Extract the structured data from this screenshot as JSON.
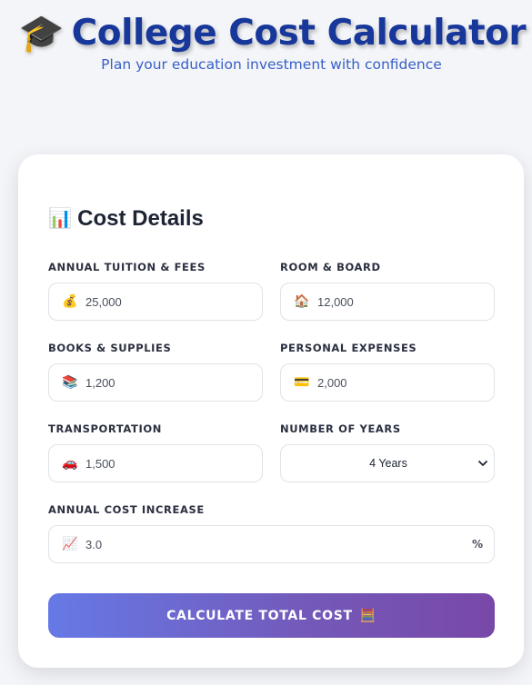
{
  "header": {
    "icon": "🎓",
    "title": "College Cost Calculator",
    "subtitle": "Plan your education investment with confidence"
  },
  "section": {
    "icon": "📊",
    "title": "Cost Details"
  },
  "fields": {
    "tuition": {
      "label": "Annual Tuition & Fees",
      "icon": "💰",
      "value": "25,000"
    },
    "room": {
      "label": "Room & Board",
      "icon": "🏠",
      "value": "12,000"
    },
    "books": {
      "label": "Books & Supplies",
      "icon": "📚",
      "value": "1,200"
    },
    "personal": {
      "label": "Personal Expenses",
      "icon": "💳",
      "value": "2,000"
    },
    "transport": {
      "label": "Transportation",
      "icon": "🚗",
      "value": "1,500"
    },
    "years": {
      "label": "Number of Years",
      "value": "4 Years"
    },
    "increase": {
      "label": "Annual Cost Increase",
      "icon": "📈",
      "value": "3.0",
      "suffix": "%"
    }
  },
  "button": {
    "label": "CALCULATE TOTAL COST",
    "icon": "🧮"
  },
  "colors": {
    "title": "#17379a",
    "subtitle": "#3760c8",
    "button_start": "#6679e6",
    "button_end": "#7848a8"
  }
}
